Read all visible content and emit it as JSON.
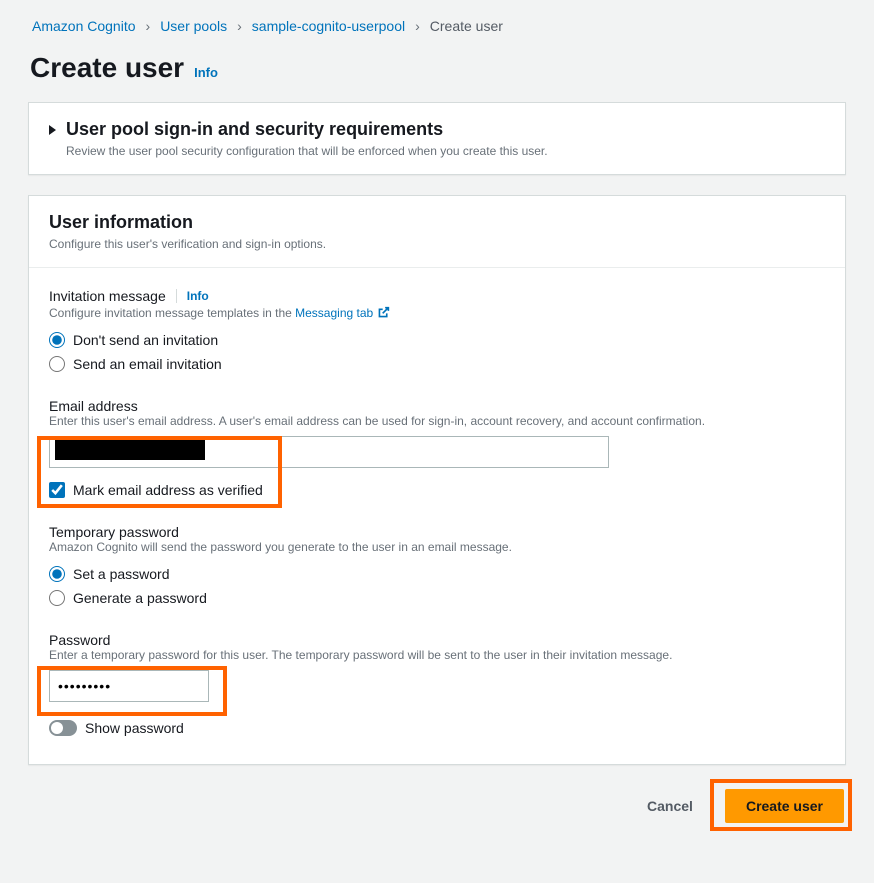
{
  "breadcrumb": {
    "items": [
      "Amazon Cognito",
      "User pools",
      "sample-cognito-userpool"
    ],
    "current": "Create user"
  },
  "page": {
    "title": "Create user",
    "info": "Info"
  },
  "requirements_panel": {
    "title": "User pool sign-in and security requirements",
    "subtext": "Review the user pool security configuration that will be enforced when you create this user."
  },
  "user_info_panel": {
    "title": "User information",
    "subtext": "Configure this user's verification and sign-in options."
  },
  "invitation": {
    "label": "Invitation message",
    "info": "Info",
    "desc_prefix": "Configure invitation message templates in the ",
    "desc_link": "Messaging tab",
    "options": {
      "dont_send": "Don't send an invitation",
      "send_email": "Send an email invitation"
    }
  },
  "email": {
    "label": "Email address",
    "desc": "Enter this user's email address. A user's email address can be used for sign-in, account recovery, and account confirmation.",
    "value": "",
    "verified_label": "Mark email address as verified"
  },
  "temp_password": {
    "label": "Temporary password",
    "desc": "Amazon Cognito will send the password you generate to the user in an email message.",
    "options": {
      "set": "Set a password",
      "generate": "Generate a password"
    }
  },
  "password": {
    "label": "Password",
    "desc": "Enter a temporary password for this user. The temporary password will be sent to the user in their invitation message.",
    "value": "•••••••••",
    "show_label": "Show password"
  },
  "footer": {
    "cancel": "Cancel",
    "submit": "Create user"
  }
}
